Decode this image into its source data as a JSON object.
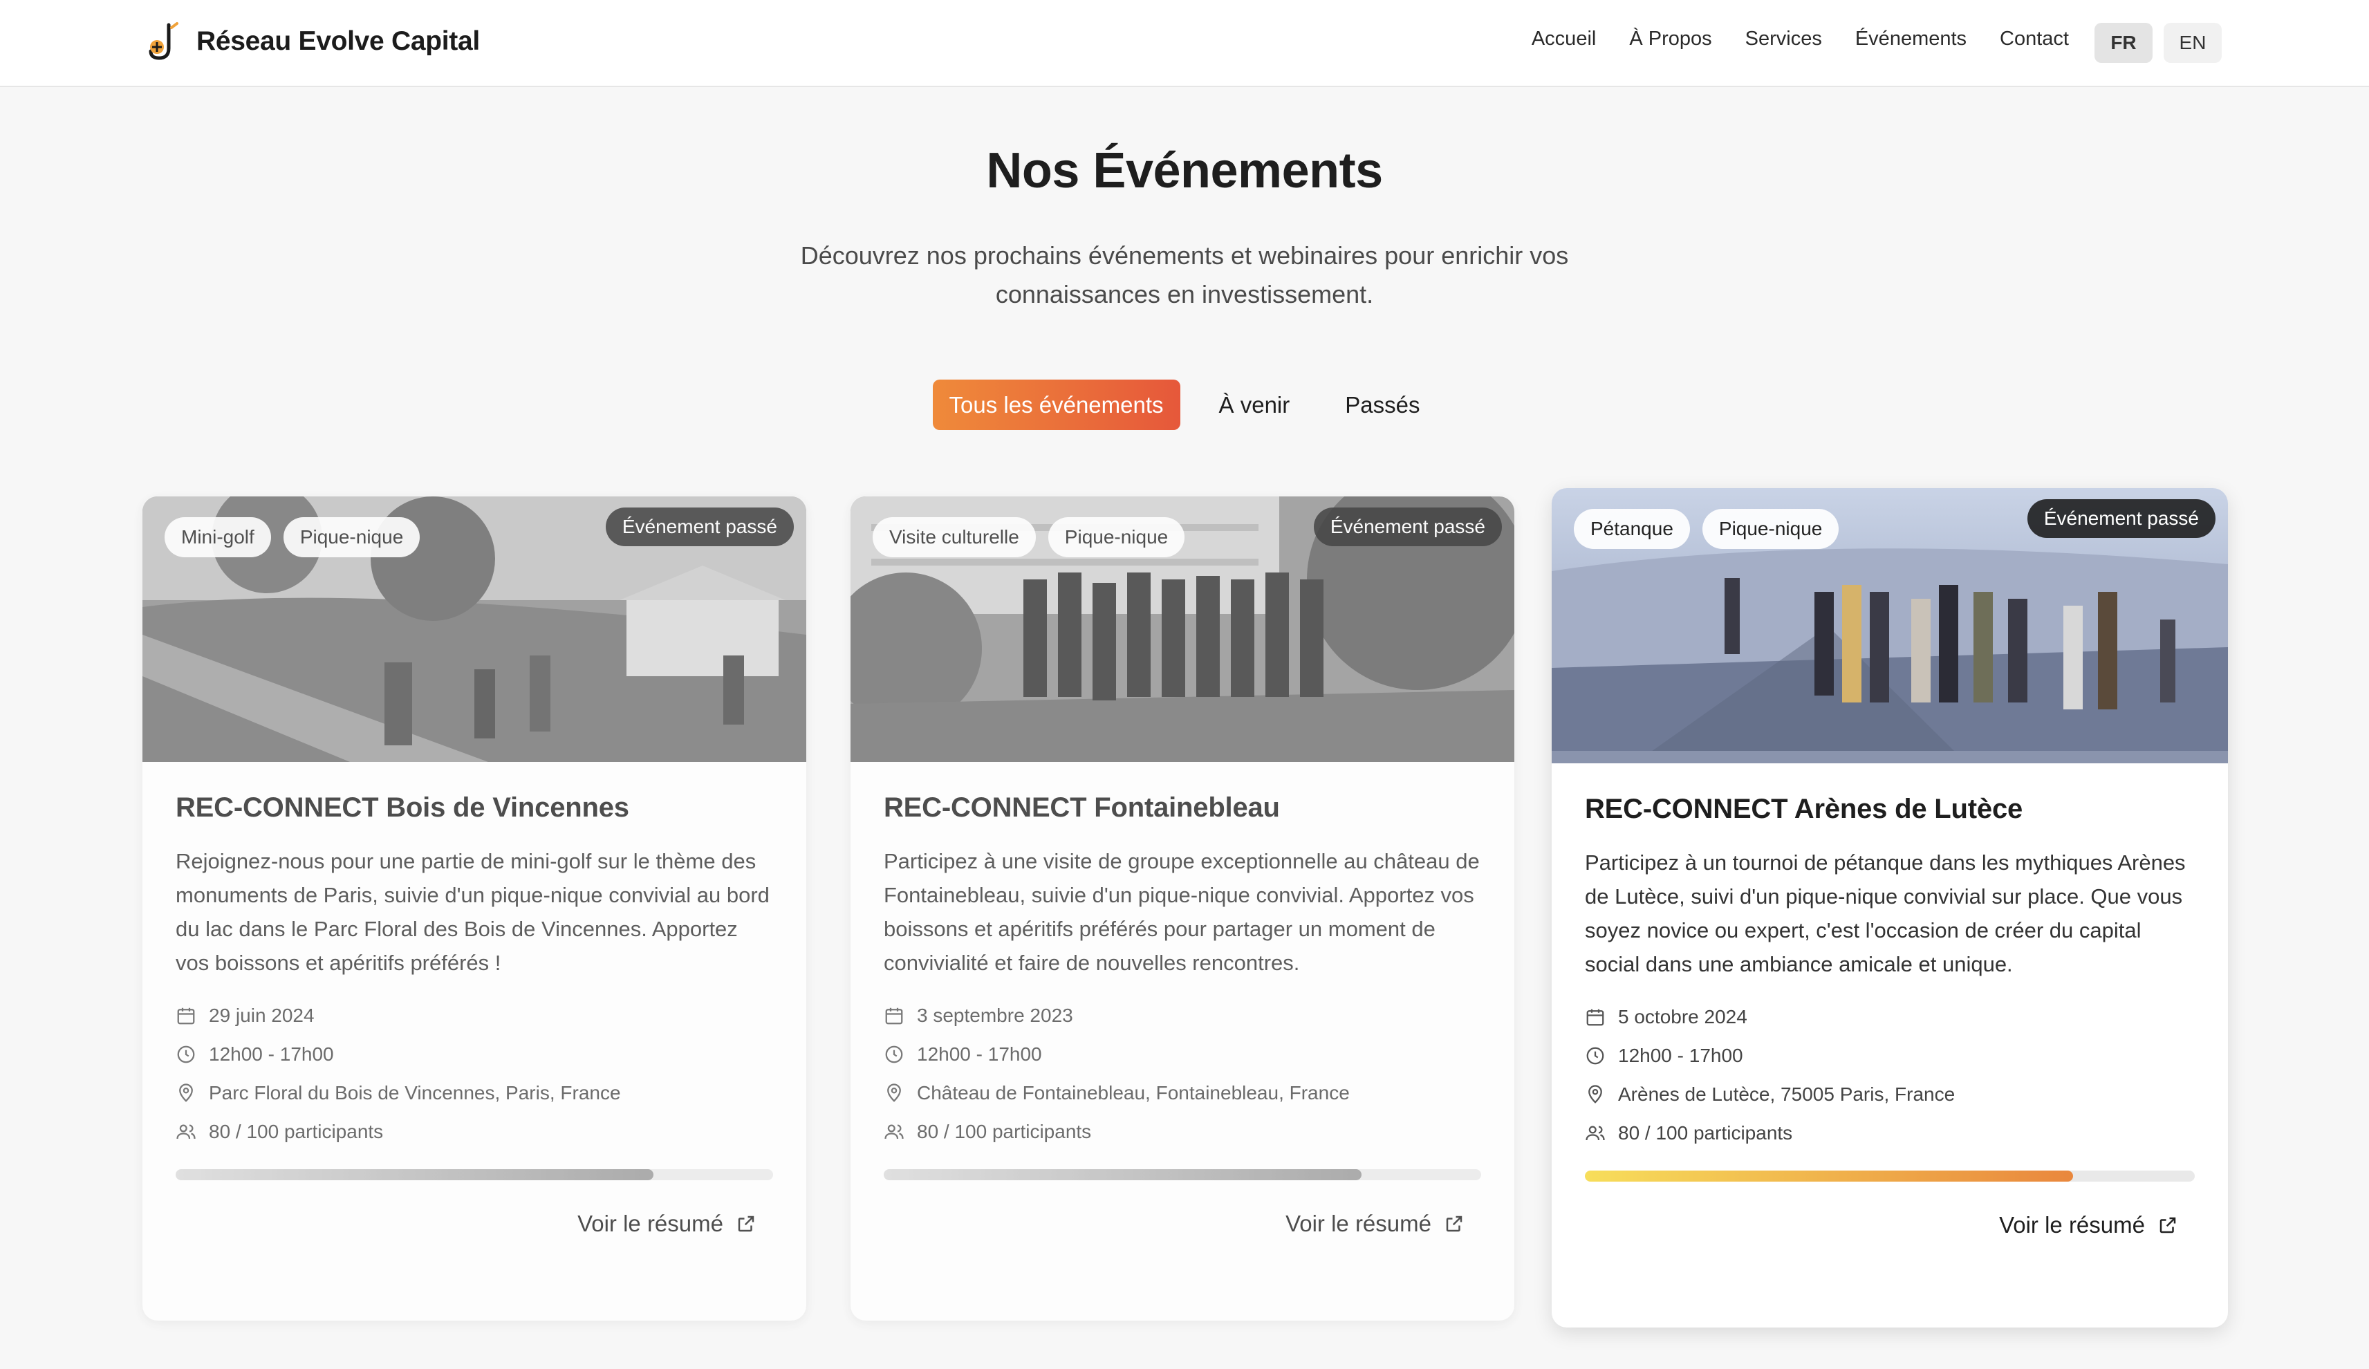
{
  "header": {
    "brand": "Réseau Evolve Capital",
    "nav": [
      "Accueil",
      "À Propos",
      "Services",
      "Événements",
      "Contact"
    ],
    "languages": {
      "fr": "FR",
      "en": "EN",
      "active": "FR"
    }
  },
  "hero": {
    "title": "Nos Événements",
    "subtitle": "Découvrez nos prochains événements et webinaires pour enrichir vos connaissances en investissement."
  },
  "filters": {
    "all": "Tous les événements",
    "upcoming": "À venir",
    "past": "Passés",
    "active": "all"
  },
  "colors": {
    "accent_start": "#ef8a3a",
    "accent_end": "#e6583a",
    "progress_start": "#f7de5b",
    "progress_end": "#e9873d"
  },
  "events": [
    {
      "tags": [
        "Mini-golf",
        "Pique-nique"
      ],
      "badge": "Événement passé",
      "title": "REC-CONNECT Bois de Vincennes",
      "description": "Rejoignez-nous pour une partie de mini-golf sur le thème des monuments de Paris, suivie d'un pique-nique convivial au bord du lac dans le Parc Floral des Bois de Vincennes. Apportez vos boissons et apéritifs préférés !",
      "date": "29 juin 2024",
      "time": "12h00 - 17h00",
      "location": "Parc Floral du Bois de Vincennes, Paris, France",
      "participants": "80 / 100 participants",
      "fill_fraction": 0.8,
      "link": "Voir le résumé"
    },
    {
      "tags": [
        "Visite culturelle",
        "Pique-nique"
      ],
      "badge": "Événement passé",
      "title": "REC-CONNECT Fontainebleau",
      "description": "Participez à une visite de groupe exceptionnelle au château de Fontainebleau, suivie d'un pique-nique convivial. Apportez vos boissons et apéritifs préférés pour partager un moment de convivialité et faire de nouvelles rencontres.",
      "date": "3 septembre 2023",
      "time": "12h00 - 17h00",
      "location": "Château de Fontainebleau, Fontainebleau, France",
      "participants": "80 / 100 participants",
      "fill_fraction": 0.8,
      "link": "Voir le résumé"
    },
    {
      "tags": [
        "Pétanque",
        "Pique-nique"
      ],
      "badge": "Événement passé",
      "title": "REC-CONNECT Arènes de Lutèce",
      "description": "Participez à un tournoi de pétanque dans les mythiques Arènes de Lutèce, suivi d'un pique-nique convivial sur place. Que vous soyez novice ou expert, c'est l'occasion de créer du capital social dans une ambiance amicale et unique.",
      "date": "5 octobre 2024",
      "time": "12h00 - 17h00",
      "location": "Arènes de Lutèce, 75005 Paris, France",
      "participants": "80 / 100 participants",
      "fill_fraction": 0.8,
      "link": "Voir le résumé"
    }
  ]
}
